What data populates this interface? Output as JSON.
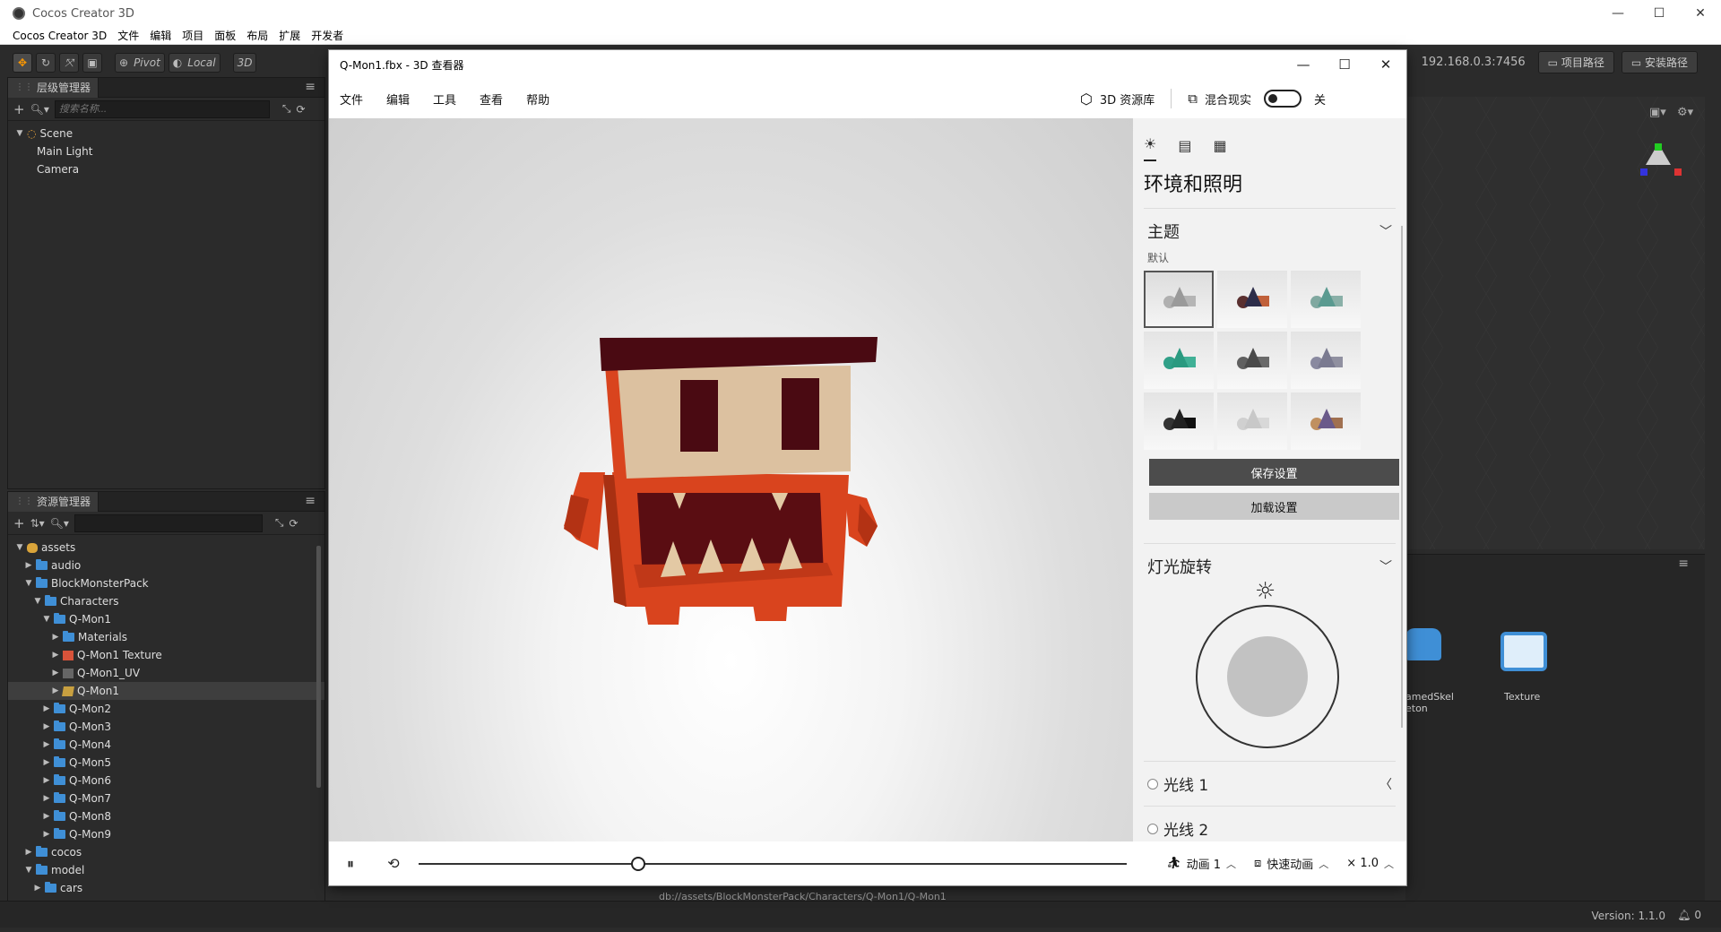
{
  "outer": {
    "title": "Cocos Creator 3D",
    "menu": [
      "Cocos Creator 3D",
      "文件",
      "编辑",
      "项目",
      "面板",
      "布局",
      "扩展",
      "开发者"
    ],
    "controls": {
      "minimize": "—",
      "maximize": "☐",
      "close": "✕"
    }
  },
  "toolbar": {
    "pivot": "Pivot",
    "local": "Local",
    "mode3d": "3D",
    "ip": "192.168.0.3:7456",
    "project_path": "项目路径",
    "install_path": "安装路径"
  },
  "hierarchy": {
    "tab": "层级管理器",
    "search_placeholder": "搜索名称...",
    "items": [
      {
        "label": "Scene",
        "level": 0
      },
      {
        "label": "Main Light",
        "level": 1
      },
      {
        "label": "Camera",
        "level": 1
      }
    ]
  },
  "assets": {
    "tab": "资源管理器",
    "items": [
      {
        "label": "assets",
        "level": 0,
        "icon": "db",
        "open": true
      },
      {
        "label": "audio",
        "level": 1,
        "icon": "folder",
        "open": false
      },
      {
        "label": "BlockMonsterPack",
        "level": 1,
        "icon": "folder",
        "open": true
      },
      {
        "label": "Characters",
        "level": 2,
        "icon": "folder",
        "open": true
      },
      {
        "label": "Q-Mon1",
        "level": 3,
        "icon": "folder",
        "open": true
      },
      {
        "label": "Materials",
        "level": 4,
        "icon": "folder",
        "open": false
      },
      {
        "label": "Q-Mon1 Texture",
        "level": 4,
        "icon": "texture",
        "open": false
      },
      {
        "label": "Q-Mon1_UV",
        "level": 4,
        "icon": "uv",
        "open": false
      },
      {
        "label": "Q-Mon1",
        "level": 4,
        "icon": "prefab",
        "open": false,
        "selected": true
      },
      {
        "label": "Q-Mon2",
        "level": 3,
        "icon": "folder",
        "open": false
      },
      {
        "label": "Q-Mon3",
        "level": 3,
        "icon": "folder",
        "open": false
      },
      {
        "label": "Q-Mon4",
        "level": 3,
        "icon": "folder",
        "open": false
      },
      {
        "label": "Q-Mon5",
        "level": 3,
        "icon": "folder",
        "open": false
      },
      {
        "label": "Q-Mon6",
        "level": 3,
        "icon": "folder",
        "open": false
      },
      {
        "label": "Q-Mon7",
        "level": 3,
        "icon": "folder",
        "open": false
      },
      {
        "label": "Q-Mon8",
        "level": 3,
        "icon": "folder",
        "open": false
      },
      {
        "label": "Q-Mon9",
        "level": 3,
        "icon": "folder",
        "open": false
      },
      {
        "label": "cocos",
        "level": 1,
        "icon": "folder",
        "open": false
      },
      {
        "label": "model",
        "level": 1,
        "icon": "folder",
        "open": true
      },
      {
        "label": "cars",
        "level": 2,
        "icon": "folder",
        "open": false
      }
    ]
  },
  "asset_preview": {
    "item1": "amedSkel eton",
    "item2": "Texture"
  },
  "status": {
    "path": "db://assets/BlockMonsterPack/Characters/Q-Mon1/Q-Mon1",
    "version": "Version: 1.1.0",
    "notifications": "0"
  },
  "viewer": {
    "title": "Q-Mon1.fbx - 3D 查看器",
    "menu": [
      "文件",
      "编辑",
      "工具",
      "查看",
      "帮助"
    ],
    "library": "3D 资源库",
    "mixed_reality": "混合现实",
    "mr_state": "关",
    "panel": {
      "heading": "环境和照明",
      "theme_title": "主题",
      "theme_sub": "默认",
      "save": "保存设置",
      "load": "加载设置",
      "light_rotation": "灯光旋转",
      "light1": "光线 1",
      "light2": "光线 2"
    },
    "themes": [
      {
        "cone": "#9a9a9a",
        "box": "#b5b5b5",
        "ball": "#b0b0b0"
      },
      {
        "cone": "#2d2d4a",
        "box": "#c0603a",
        "ball": "#5a3030"
      },
      {
        "cone": "#5a9a90",
        "box": "#8ab0a8",
        "ball": "#80a8a0"
      },
      {
        "cone": "#2a9a80",
        "box": "#40b096",
        "ball": "#30a088"
      },
      {
        "cone": "#4a4a4a",
        "box": "#6a6a6a",
        "ball": "#606060"
      },
      {
        "cone": "#7a7a90",
        "box": "#9090a0",
        "ball": "#8a8aa0"
      },
      {
        "cone": "#222222",
        "box": "#111111",
        "ball": "#333333"
      },
      {
        "cone": "#c8c8c8",
        "box": "#d8d8d8",
        "ball": "#d0d0d0"
      },
      {
        "cone": "#6a5a8a",
        "box": "#a07050",
        "ball": "#c09060"
      }
    ],
    "playback": {
      "animation": "动画 1",
      "quick": "快速动画",
      "speed": "× 1.0",
      "progress": 0.31
    }
  }
}
